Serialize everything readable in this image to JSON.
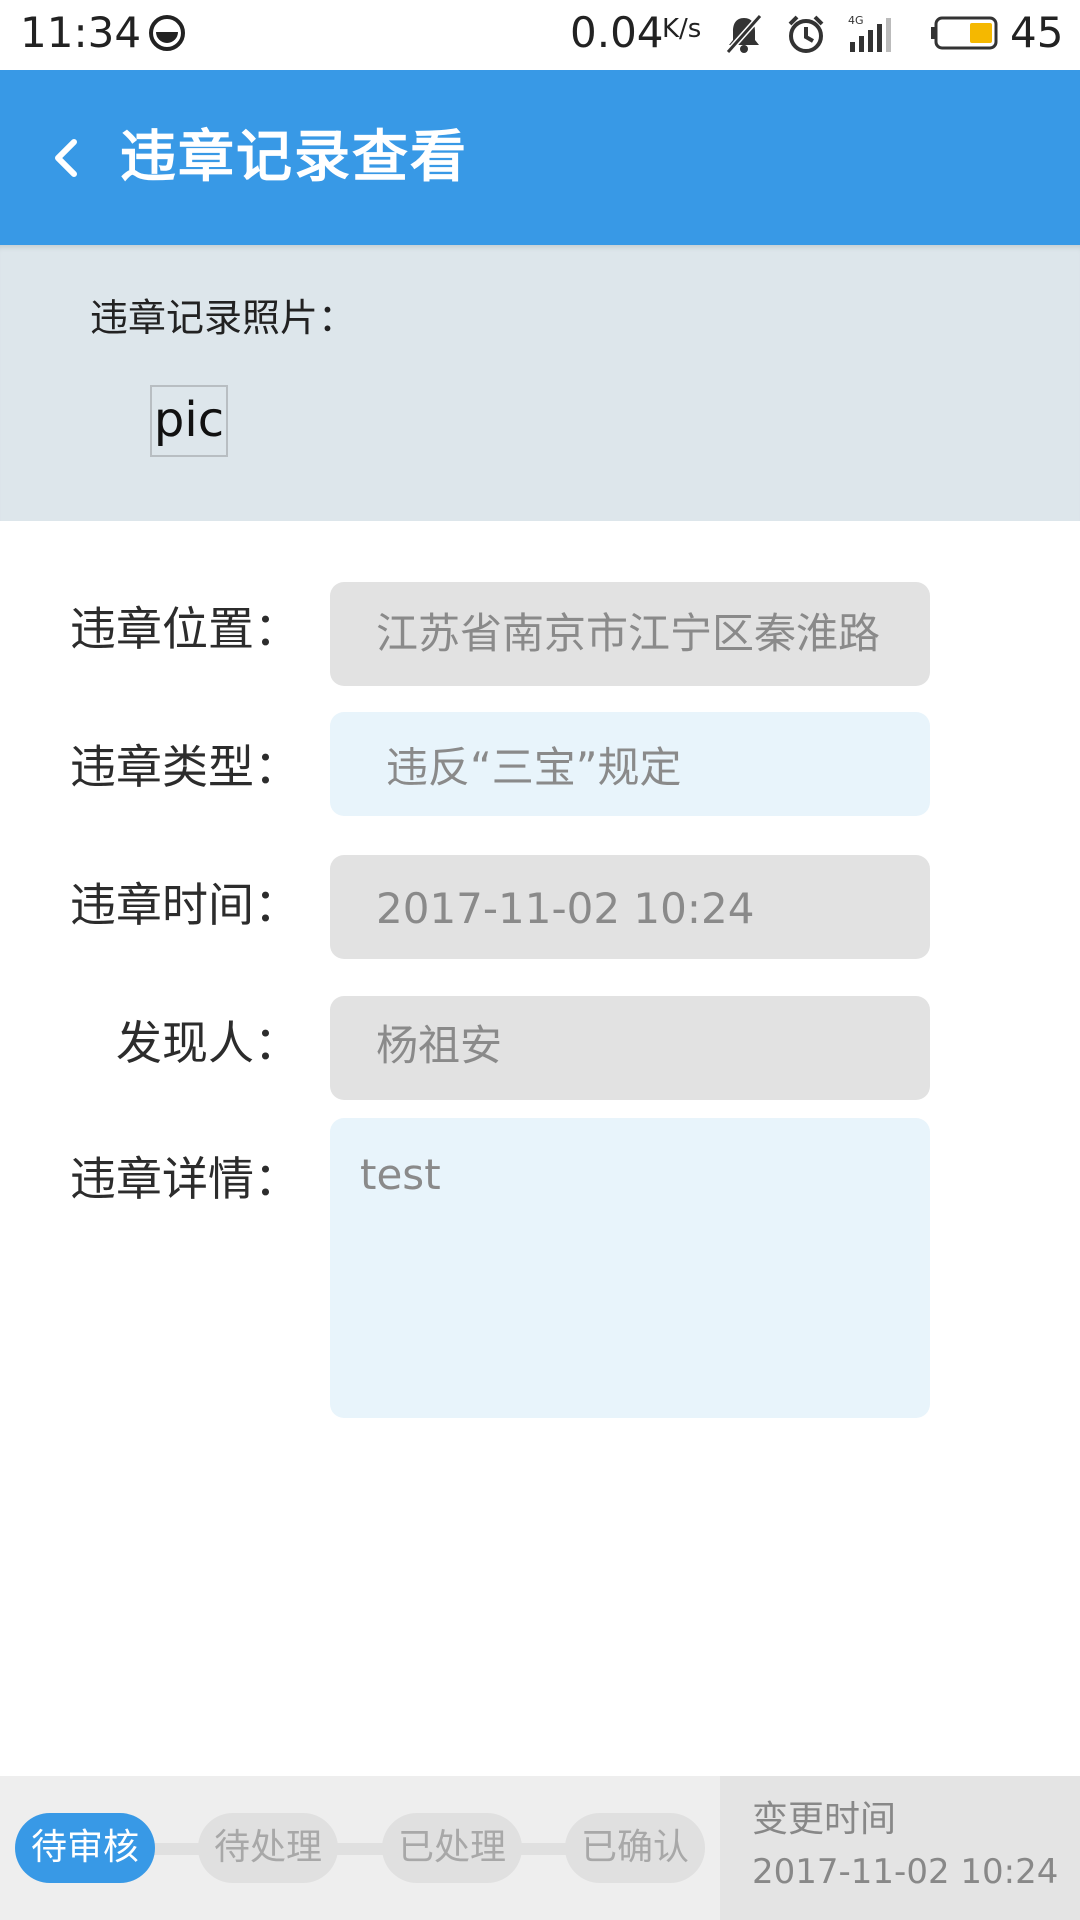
{
  "status_bar": {
    "time": "11:34",
    "net_speed": "0.04",
    "net_speed_unit": "K/s",
    "network_type": "4G",
    "battery_level": "45",
    "icons": [
      "app-notification-icon",
      "mute-icon",
      "alarm-icon",
      "signal-icon",
      "battery-icon"
    ]
  },
  "header": {
    "title": "违章记录查看",
    "back_icon": "chevron-left-icon"
  },
  "photo_section": {
    "label": "违章记录照片：",
    "placeholder_text": "pic"
  },
  "form": {
    "location": {
      "label": "违章位置：",
      "value": "江苏省南京市江宁区秦淮路"
    },
    "type": {
      "label": "违章类型：",
      "value": "违反“三宝”规定"
    },
    "time": {
      "label": "违章时间：",
      "value": "2017-11-02 10:24"
    },
    "finder": {
      "label": "发现人：",
      "value": "杨祖安"
    },
    "details": {
      "label": "违章详情：",
      "value": "test"
    }
  },
  "workflow": {
    "steps": [
      {
        "label": "待审核",
        "active": true
      },
      {
        "label": "待处理",
        "active": false
      },
      {
        "label": "已处理",
        "active": false
      },
      {
        "label": "已确认",
        "active": false
      }
    ],
    "change_time_label": "变更时间",
    "change_time_value": "2017-11-02 10:24"
  },
  "colors": {
    "primary": "#3899e6",
    "photo_background": "#dde6eb",
    "field_gray": "#e2e2e2",
    "field_blue": "#e8f4fb",
    "battery_fill": "#f5b800"
  }
}
